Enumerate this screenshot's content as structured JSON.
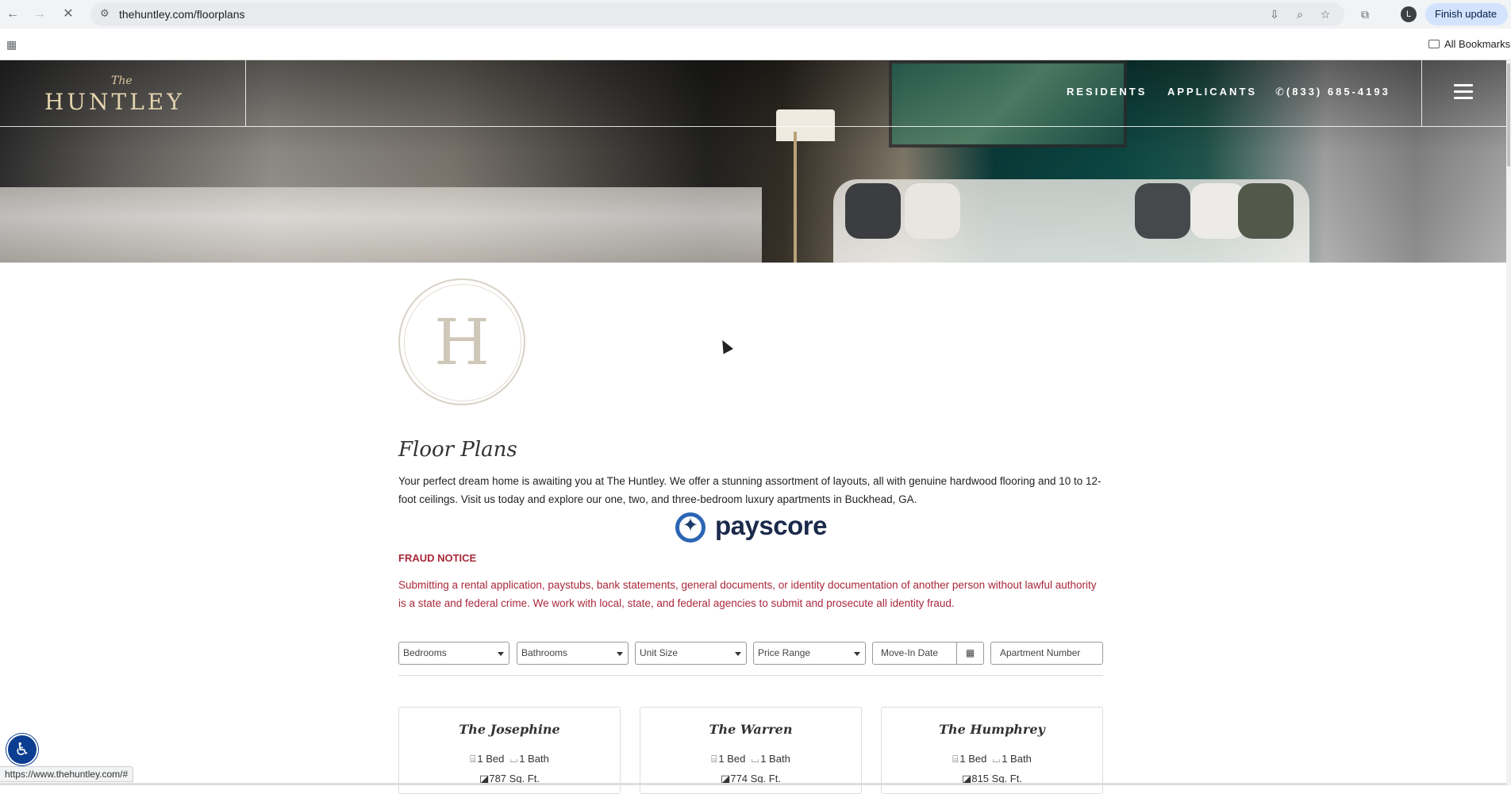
{
  "browser": {
    "url": "thehuntley.com/floorplans",
    "finish_update": "Finish update",
    "avatar_letter": "L",
    "all_bookmarks": "All Bookmarks",
    "status_url": "https://www.thehuntley.com/#"
  },
  "site": {
    "logo_the": "The",
    "logo_name": "HUNTLEY",
    "nav": {
      "residents": "RESIDENTS",
      "applicants": "APPLICANTS",
      "phone": "(833) 685-4193"
    },
    "monogram": "H"
  },
  "content": {
    "title": "Floor Plans",
    "intro": "Your perfect dream home is awaiting you at The Huntley. We offer a stunning assortment of layouts, all with genuine hardwood flooring and 10 to 12-foot ceilings. Visit us today and explore our one, two, and three-bedroom luxury apartments in Buckhead, GA.",
    "payscore": "payscore",
    "fraud_title": "FRAUD NOTICE",
    "fraud_text": "Submitting a rental application, paystubs, bank statements, general documents, or identity documentation of another person without lawful authority is a state and federal crime. We work with local, state, and federal agencies to submit and prosecute all identity fraud."
  },
  "filters": {
    "bedrooms": "Bedrooms",
    "bathrooms": "Bathrooms",
    "unit_size": "Unit Size",
    "price_range": "Price Range",
    "move_in_date": "Move-In Date",
    "apartment_number": "Apartment Number"
  },
  "floorplans": [
    {
      "name": "The Josephine",
      "bed": "1 Bed",
      "bath": "1 Bath",
      "sqft": "787 Sq. Ft."
    },
    {
      "name": "The Warren",
      "bed": "1 Bed",
      "bath": "1 Bath",
      "sqft": "774 Sq. Ft."
    },
    {
      "name": "The Humphrey",
      "bed": "1 Bed",
      "bath": "1 Bath",
      "sqft": "815 Sq. Ft."
    }
  ],
  "colors": {
    "fraud_red": "#a8283a",
    "logo_gold": "#e3d3ad",
    "payscore_blue": "#2a66b4",
    "a11y_blue": "#0b3d91"
  },
  "icons": {
    "back": "arrow-left-icon",
    "forward": "arrow-right-icon",
    "stop": "close-icon",
    "site_info": "tune-icon",
    "install": "install-icon",
    "zoom": "zoom-icon",
    "bookmark": "star-icon",
    "tab_search": "tab-search-icon",
    "apps": "apps-grid-icon",
    "phone": "phone-icon",
    "menu": "hamburger-icon",
    "accessibility": "accessibility-icon",
    "calendar": "calendar-icon",
    "bed": "bed-icon",
    "bath": "bath-icon",
    "sqft": "floorplan-icon"
  }
}
